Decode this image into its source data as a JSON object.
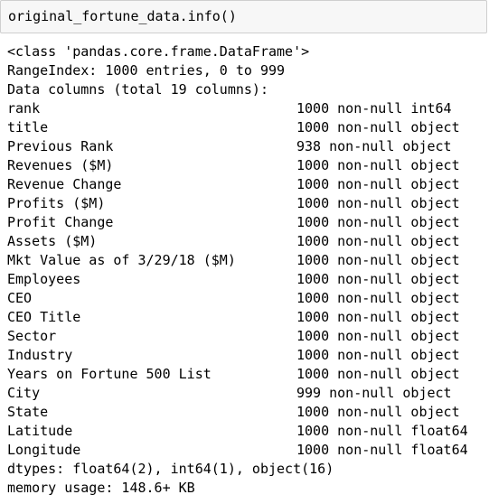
{
  "input": {
    "code": "original_fortune_data.info()"
  },
  "output": {
    "class_line": "<class 'pandas.core.frame.DataFrame'>",
    "index_line": "RangeIndex: 1000 entries, 0 to 999",
    "columns_header": "Data columns (total 19 columns):",
    "columns": [
      {
        "name": "rank",
        "info": "1000 non-null int64"
      },
      {
        "name": "title",
        "info": "1000 non-null object"
      },
      {
        "name": "Previous Rank",
        "info": "938 non-null object"
      },
      {
        "name": "Revenues ($M)",
        "info": "1000 non-null object"
      },
      {
        "name": "Revenue Change",
        "info": "1000 non-null object"
      },
      {
        "name": "Profits ($M)",
        "info": "1000 non-null object"
      },
      {
        "name": "Profit Change",
        "info": "1000 non-null object"
      },
      {
        "name": "Assets ($M)",
        "info": "1000 non-null object"
      },
      {
        "name": "Mkt Value as of 3/29/18 ($M)",
        "info": "1000 non-null object"
      },
      {
        "name": "Employees",
        "info": "1000 non-null object"
      },
      {
        "name": "CEO",
        "info": "1000 non-null object"
      },
      {
        "name": "CEO Title",
        "info": "1000 non-null object"
      },
      {
        "name": "Sector",
        "info": "1000 non-null object"
      },
      {
        "name": "Industry",
        "info": "1000 non-null object"
      },
      {
        "name": "Years on Fortune 500 List",
        "info": "1000 non-null object"
      },
      {
        "name": "City",
        "info": "999 non-null object"
      },
      {
        "name": "State",
        "info": "1000 non-null object"
      },
      {
        "name": "Latitude",
        "info": "1000 non-null float64"
      },
      {
        "name": "Longitude",
        "info": "1000 non-null float64"
      }
    ],
    "dtypes_line": "dtypes: float64(2), int64(1), object(16)",
    "memory_line": "memory usage: 148.6+ KB"
  }
}
